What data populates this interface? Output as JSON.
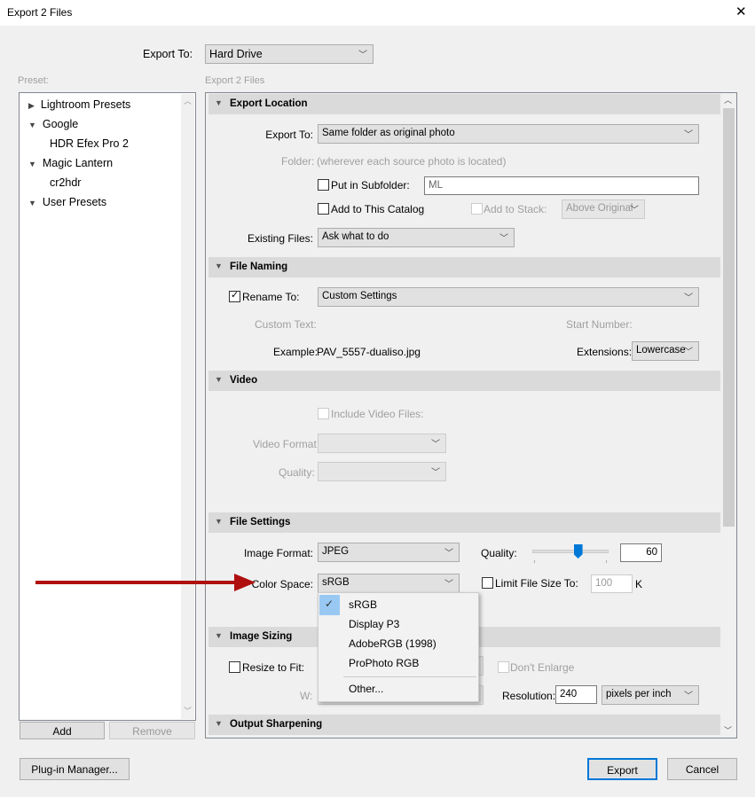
{
  "window": {
    "title": "Export 2 Files",
    "close": "✕"
  },
  "top": {
    "export_to_label": "Export To:",
    "export_to_value": "Hard Drive"
  },
  "preset": {
    "label": "Preset:",
    "items": [
      "Lightroom Presets",
      "Google",
      "HDR Efex Pro 2",
      "Magic Lantern",
      "cr2hdr",
      "User Presets"
    ],
    "add": "Add",
    "remove": "Remove"
  },
  "main_label": "Export 2 Files",
  "export_location": {
    "title": "Export Location",
    "export_to_label": "Export To:",
    "export_to_value": "Same folder as original photo",
    "folder_label": "Folder:",
    "folder_value": "(wherever each source photo is located)",
    "subfolder_label": "Put in Subfolder:",
    "subfolder_value": "ML",
    "catalog_label": "Add to This Catalog",
    "stack_label": "Add to Stack:",
    "stack_value": "Above Original",
    "existing_label": "Existing Files:",
    "existing_value": "Ask what to do"
  },
  "file_naming": {
    "title": "File Naming",
    "rename_label": "Rename To:",
    "rename_value": "Custom Settings",
    "custom_text_label": "Custom Text:",
    "start_number_label": "Start Number:",
    "example_label": "Example:",
    "example_value": "PAV_5557-dualiso.jpg",
    "extensions_label": "Extensions:",
    "extensions_value": "Lowercase"
  },
  "video": {
    "title": "Video",
    "include_label": "Include Video Files:",
    "format_label": "Video Format:",
    "quality_label": "Quality:"
  },
  "file_settings": {
    "title": "File Settings",
    "format_label": "Image Format:",
    "format_value": "JPEG",
    "quality_label": "Quality:",
    "quality_value": "60",
    "quality_fraction": 0.6,
    "color_space_label": "Color Space:",
    "color_space_value": "sRGB",
    "limit_label": "Limit File Size To:",
    "limit_value": "100",
    "limit_unit": "K"
  },
  "color_menu": {
    "items": [
      "sRGB",
      "Display P3",
      "AdobeRGB (1998)",
      "ProPhoto RGB"
    ],
    "other": "Other...",
    "check": "✓"
  },
  "image_sizing": {
    "title": "Image Sizing",
    "resize_label": "Resize to Fit:",
    "enlarge_label": "Don't Enlarge",
    "w_label": "W:",
    "resolution_label": "Resolution:",
    "resolution_value": "240",
    "resolution_unit": "pixels per inch"
  },
  "output_sharpening": {
    "title": "Output Sharpening"
  },
  "footer": {
    "plugin": "Plug-in Manager...",
    "export": "Export",
    "cancel": "Cancel"
  },
  "colors": {
    "accent": "#0078d7",
    "arrow": "#b00f0f"
  }
}
